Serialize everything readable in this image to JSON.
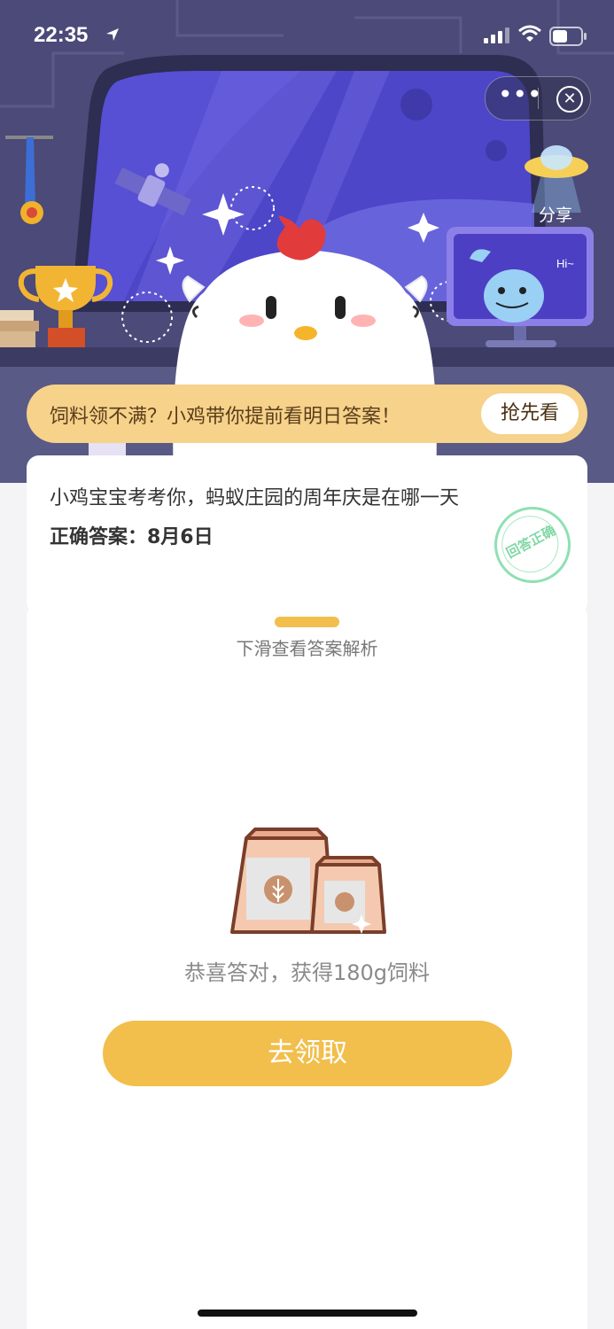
{
  "status_bar": {
    "time": "22:35"
  },
  "capsule": {
    "more_label": "•••"
  },
  "share": {
    "label": "分享"
  },
  "hero": {
    "monitor_text": "Hi~"
  },
  "banner": {
    "text": "饲料领不满？小鸡带你提前看明日答案！",
    "button_label": "抢先看"
  },
  "question_card": {
    "question": "小鸡宝宝考考你，蚂蚁庄园的周年庆是在哪一天",
    "answer": "正确答案：8月6日",
    "stamp_text": "回答正确"
  },
  "bottom_sheet": {
    "hint": "下滑查看答案解析",
    "congrats": "恭喜答对，获得180g饲料",
    "claim_button": "去领取"
  },
  "colors": {
    "accent": "#f2be4c",
    "banner_bg": "#f6d28a",
    "hero_bg": "#4b4a78",
    "stamp_green": "#7fd8a5"
  }
}
